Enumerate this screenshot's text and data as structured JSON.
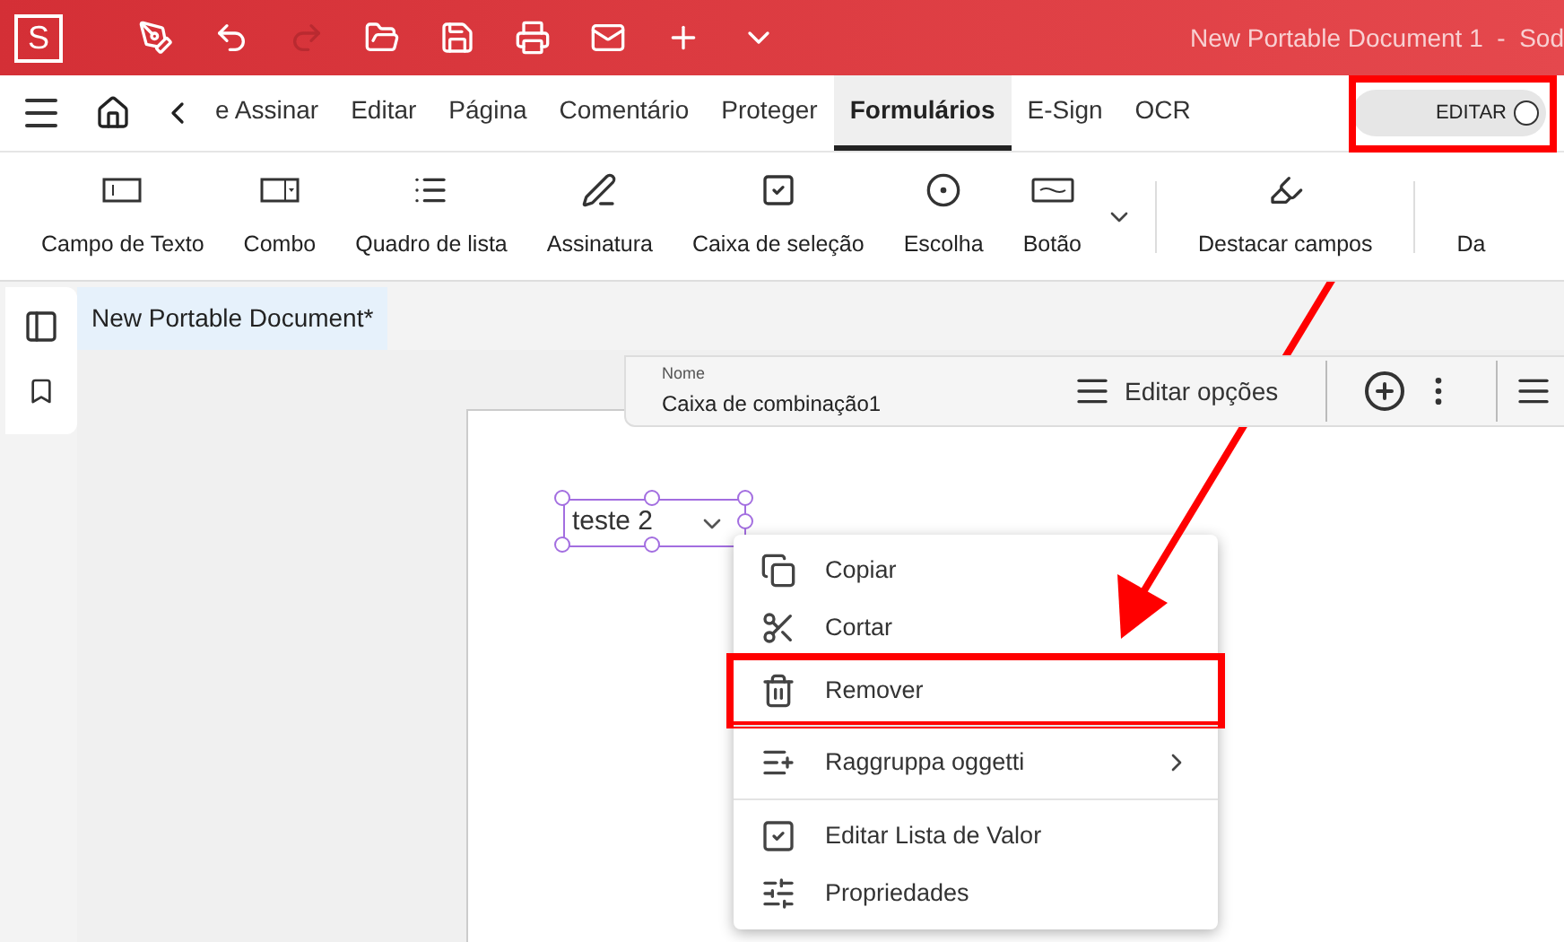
{
  "title_bar": {
    "logo": "S",
    "title": "New Portable Document 1  -  Sod"
  },
  "tabs": [
    {
      "label": "e Assinar",
      "selected": false
    },
    {
      "label": "Editar",
      "selected": false
    },
    {
      "label": "Página",
      "selected": false
    },
    {
      "label": "Comentário",
      "selected": false
    },
    {
      "label": "Proteger",
      "selected": false
    },
    {
      "label": "Formulários",
      "selected": true
    },
    {
      "label": "E-Sign",
      "selected": false
    },
    {
      "label": "OCR",
      "selected": false
    }
  ],
  "edit_toggle": {
    "label": "EDITAR",
    "on": false,
    "highlighted": true
  },
  "ribbon": [
    {
      "label": "Campo de Texto",
      "kind": "textfield"
    },
    {
      "label": "Combo",
      "kind": "combo"
    },
    {
      "label": "Quadro de lista",
      "kind": "list"
    },
    {
      "label": "Assinatura",
      "kind": "signature"
    },
    {
      "label": "Caixa de seleção",
      "kind": "checkbox"
    },
    {
      "label": "Escolha",
      "kind": "radio"
    },
    {
      "label": "Botão",
      "kind": "button"
    },
    {
      "label": "Destacar campos",
      "kind": "highlight"
    },
    {
      "label": "Da",
      "kind": "cut"
    }
  ],
  "document_tab": {
    "label": "New Portable Document*",
    "selected": true
  },
  "field_toolbar": {
    "name_label": "Nome",
    "name_value": "Caixa de combinação1",
    "edit_options": "Editar opções"
  },
  "combo_field": {
    "value": "teste 2",
    "selected": true
  },
  "context_menu": [
    {
      "kind": "item",
      "label": "Copiar",
      "highlighted": false
    },
    {
      "kind": "item",
      "label": "Cortar",
      "highlighted": false
    },
    {
      "kind": "item",
      "label": "Remover",
      "highlighted": true
    },
    {
      "kind": "divider"
    },
    {
      "kind": "submenu",
      "label": "Raggruppa oggetti",
      "highlighted": false
    },
    {
      "kind": "divider"
    },
    {
      "kind": "item",
      "label": "Editar Lista de Valor",
      "highlighted": false
    },
    {
      "kind": "item",
      "label": "Propriedades",
      "highlighted": false
    }
  ]
}
